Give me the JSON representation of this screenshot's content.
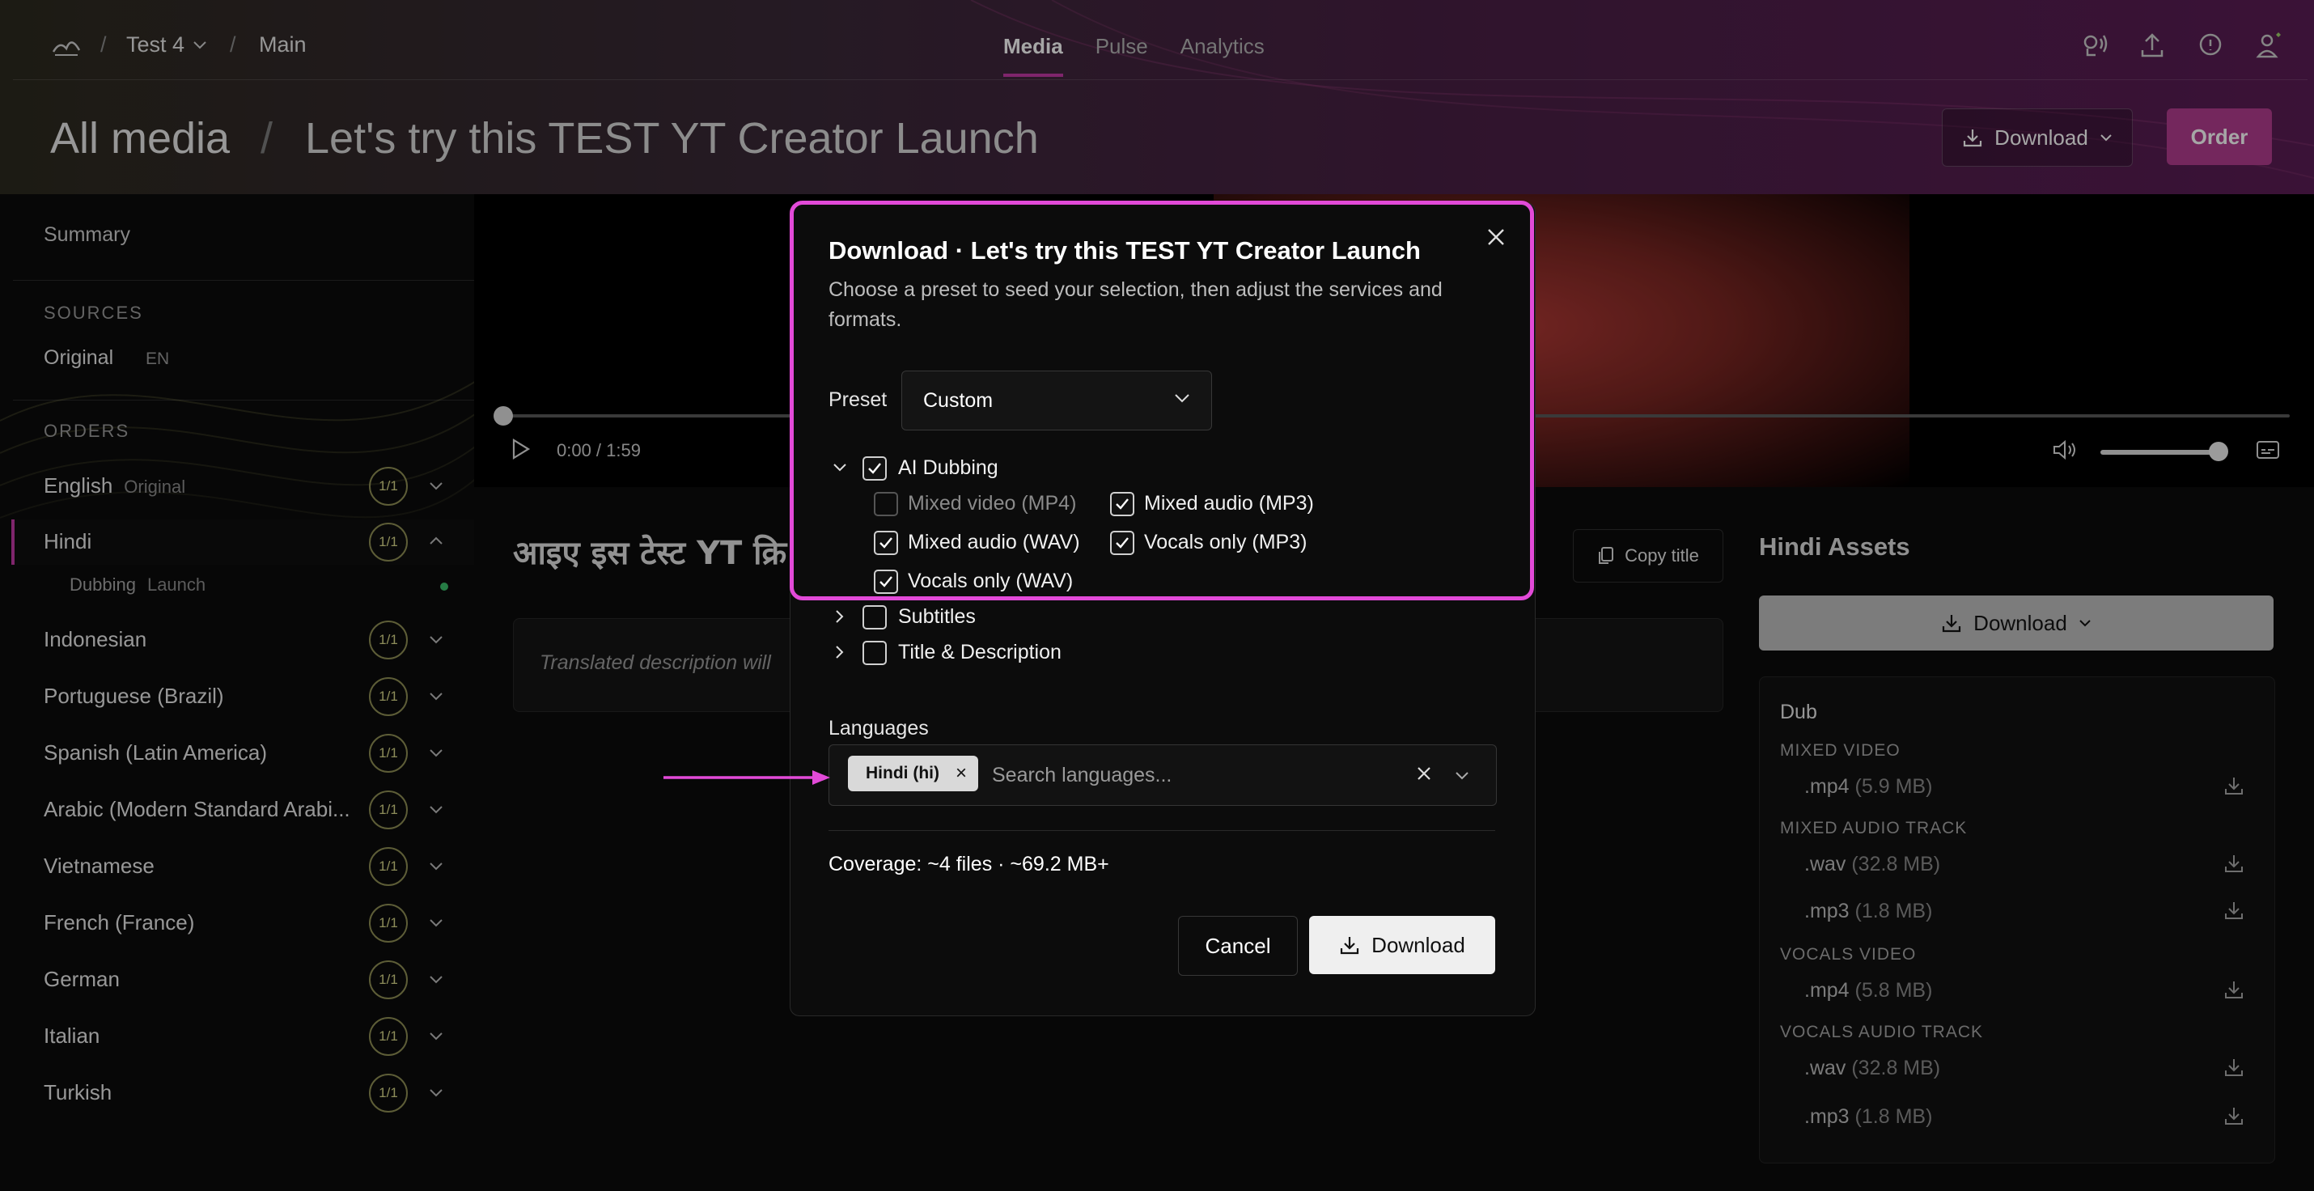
{
  "topbar": {
    "workspace": "Test 4",
    "branch": "Main",
    "tabs": [
      "Media",
      "Pulse",
      "Analytics"
    ],
    "active_tab": "Media"
  },
  "page": {
    "root_crumb": "All media",
    "separator": "/",
    "title": "Let's try this TEST YT Creator Launch",
    "download_label": "Download",
    "order_label": "Order"
  },
  "sidebar": {
    "summary": "Summary",
    "sources_header": "SOURCES",
    "source_name": "Original",
    "source_lang": "EN",
    "orders_header": "ORDERS",
    "orders": [
      {
        "lang": "English",
        "sub": "Original",
        "badge": "1/1"
      },
      {
        "lang": "Hindi",
        "sub": "",
        "badge": "1/1"
      },
      {
        "lang": "Indonesian",
        "sub": "",
        "badge": "1/1"
      },
      {
        "lang": "Portuguese (Brazil)",
        "sub": "",
        "badge": "1/1"
      },
      {
        "lang": "Spanish (Latin America)",
        "sub": "",
        "badge": "1/1"
      },
      {
        "lang": "Arabic (Modern Standard Arabi...",
        "sub": "",
        "badge": "1/1"
      },
      {
        "lang": "Vietnamese",
        "sub": "",
        "badge": "1/1"
      },
      {
        "lang": "French (France)",
        "sub": "",
        "badge": "1/1"
      },
      {
        "lang": "German",
        "sub": "",
        "badge": "1/1"
      },
      {
        "lang": "Italian",
        "sub": "",
        "badge": "1/1"
      },
      {
        "lang": "Turkish",
        "sub": "",
        "badge": "1/1"
      }
    ],
    "hindi_sub": {
      "label": "Dubbing",
      "status": "Launch"
    }
  },
  "player": {
    "time": "0:00 / 1:59",
    "volume": 0.9,
    "progress": 0.0
  },
  "content": {
    "hindi_title": "आइए इस टेस्ट YT क्रि",
    "copy_title": "Copy title",
    "description_placeholder": "Translated description will"
  },
  "assets": {
    "title": "Hindi Assets",
    "download_label": "Download",
    "card_title": "Dub",
    "sections": [
      {
        "name": "MIXED VIDEO",
        "files": [
          {
            "ext": ".mp4",
            "size": "(5.9 MB)"
          }
        ]
      },
      {
        "name": "MIXED AUDIO TRACK",
        "files": [
          {
            "ext": ".wav",
            "size": "(32.8 MB)"
          },
          {
            "ext": ".mp3",
            "size": "(1.8 MB)"
          }
        ]
      },
      {
        "name": "VOCALS VIDEO",
        "files": [
          {
            "ext": ".mp4",
            "size": "(5.8 MB)"
          }
        ]
      },
      {
        "name": "VOCALS AUDIO TRACK",
        "files": [
          {
            "ext": ".wav",
            "size": "(32.8 MB)"
          },
          {
            "ext": ".mp3",
            "size": "(1.8 MB)"
          }
        ]
      }
    ]
  },
  "modal": {
    "title": "Download · Let's try this TEST YT Creator Launch",
    "description": "Choose a preset to seed your selection, then adjust the services and formats.",
    "preset_label": "Preset",
    "preset_value": "Custom",
    "ai_dubbing": "AI Dubbing",
    "options": {
      "mixed_video_mp4": "Mixed video (MP4)",
      "mixed_audio_mp3": "Mixed audio (MP3)",
      "mixed_audio_wav": "Mixed audio (WAV)",
      "vocals_only_mp3": "Vocals only (MP3)",
      "vocals_only_wav": "Vocals only (WAV)"
    },
    "subtitles": "Subtitles",
    "title_description": "Title & Description",
    "languages_label": "Languages",
    "language_chip": "Hindi (hi)",
    "language_placeholder": "Search languages...",
    "coverage": "Coverage: ~4 files · ~69.2 MB+",
    "cancel_label": "Cancel",
    "download_label": "Download"
  },
  "colors": {
    "accent": "#c33aa6",
    "highlight": "#e24ad8",
    "order_button": "#b23d8f"
  }
}
